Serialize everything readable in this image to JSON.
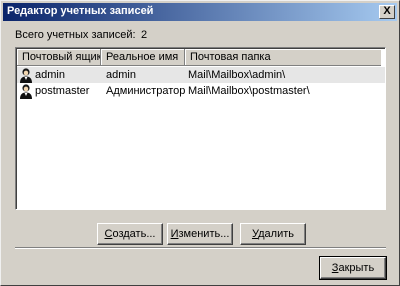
{
  "window": {
    "title": "Редактор учетных записей",
    "close_glyph": "X"
  },
  "summary": {
    "count_label": "Всего учетных записей:",
    "count_value": "2"
  },
  "table": {
    "columns": [
      "Почтовый ящик",
      "Реальное имя",
      "Почтовая папка"
    ],
    "rows": [
      {
        "mailbox": "admin",
        "real_name": "admin",
        "folder": "Mail\\Mailbox\\admin\\",
        "icon": "user-icon"
      },
      {
        "mailbox": "postmaster",
        "real_name": "Администратор",
        "folder": "Mail\\Mailbox\\postmaster\\",
        "icon": "user-icon"
      }
    ]
  },
  "buttons": {
    "create": {
      "mnemonic": "С",
      "rest": "оздать..."
    },
    "edit": {
      "mnemonic": "И",
      "rest": "зменить..."
    },
    "delete": {
      "mnemonic": "У",
      "rest": "далить"
    },
    "close": {
      "mnemonic": "З",
      "rest": "акрыть"
    }
  },
  "colors": {
    "title_start": "#0a246a",
    "title_end": "#a6caf0",
    "face": "#d4d0c8"
  }
}
